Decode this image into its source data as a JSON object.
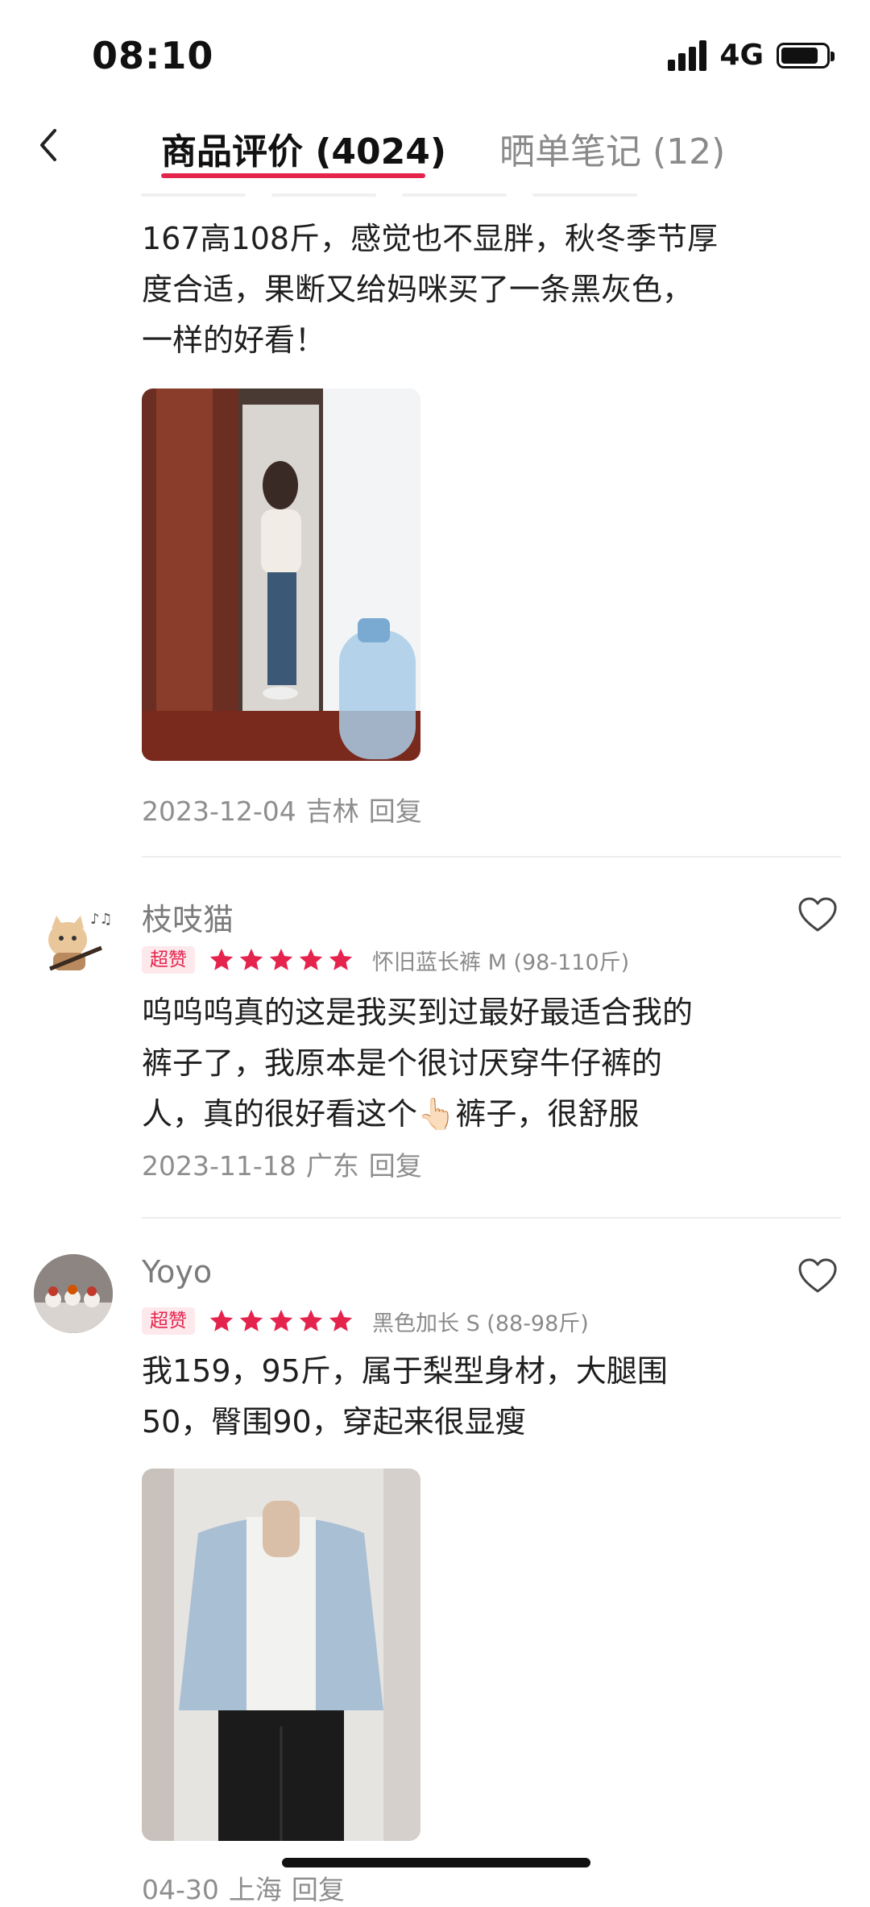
{
  "status_bar": {
    "time": "08:10",
    "network": "4G"
  },
  "header": {
    "tabs": [
      {
        "label": "商品评价 (4024)",
        "active": true
      },
      {
        "label": "晒单笔记 (12)",
        "active": false
      }
    ]
  },
  "reviews": [
    {
      "text": "167高108斤，感觉也不显胖，秋冬季节厚度合适，果断又给妈咪买了一条黑灰色，一样的好看！",
      "date": "2023-12-04",
      "location": "吉林",
      "reply_label": "回复"
    },
    {
      "username": "枝吱猫",
      "badge": "超赞",
      "rating": 5,
      "variant": "怀旧蓝长裤  M (98-110斤)",
      "text": "呜呜呜真的这是我买到过最好最适合我的裤子了，我原本是个很讨厌穿牛仔裤的人，真的很好看这个👆🏻裤子，很舒服",
      "date": "2023-11-18",
      "location": "广东",
      "reply_label": "回复"
    },
    {
      "username": "Yoyo",
      "badge": "超赞",
      "rating": 5,
      "variant": "黑色加长  S (88-98斤)",
      "text": "我159，95斤，属于梨型身材，大腿围50，臀围90，穿起来很显瘦",
      "date": "04-30",
      "location": "上海",
      "reply_label": "回复"
    }
  ],
  "colors": {
    "accent": "#e5244e",
    "star": "#e5244e",
    "muted": "#8e8e8e"
  }
}
